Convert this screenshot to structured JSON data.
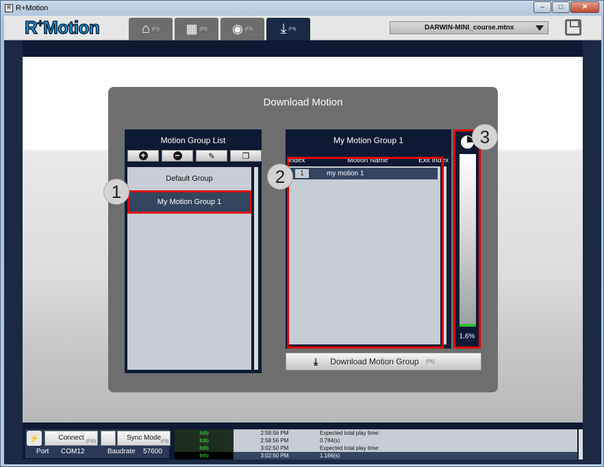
{
  "window": {
    "title": "R+Motion",
    "min": "–",
    "max": "□",
    "close": "✕"
  },
  "header": {
    "logo": {
      "prefix": "R",
      "plus": "+",
      "word": "Motion"
    },
    "tabs": [
      {
        "icon": "home-icon",
        "glyph": "⌂",
        "key": "(F1)"
      },
      {
        "icon": "film-icon",
        "glyph": "▦",
        "key": "(F2)"
      },
      {
        "icon": "reel-icon",
        "glyph": "◉",
        "key": "(F3)"
      },
      {
        "icon": "download-icon",
        "glyph": "⤓",
        "key": "(F4)"
      }
    ],
    "file": "DARWIN-MINI_course.mtnx"
  },
  "dialog": {
    "title": "Download Motion",
    "group_list": {
      "title": "Motion Group List",
      "tools": {
        "add": "+",
        "remove": "−",
        "edit": "✎",
        "copy": "❐"
      },
      "items": [
        "Default Group",
        "My Motion Group 1"
      ]
    },
    "motion_group": {
      "title": "My Motion Group 1",
      "columns": [
        "Index",
        "Motion Name",
        "Exit Index"
      ],
      "rows": [
        {
          "index": "1",
          "name": "my motion 1"
        }
      ]
    },
    "progress": {
      "percent_label": "1.6%",
      "value": 0.016
    },
    "download_button": {
      "icon": "⤓",
      "label": "Download Motion Group",
      "key": "(F6)"
    },
    "badges": [
      "1",
      "2",
      "3"
    ]
  },
  "status": {
    "connect": {
      "label": "Connect",
      "key": "(F10)"
    },
    "sync": {
      "label": "Sync Mode",
      "key": "(F9)"
    },
    "port_label": "Port",
    "port": "COM12",
    "baud_label": "Baudrate",
    "baud": "57600",
    "log": [
      {
        "level": "Info",
        "time": "2:58:56 PM",
        "msg": "Expected total play time:"
      },
      {
        "level": "Info",
        "time": "2:58:56 PM",
        "msg": "0.784(s)"
      },
      {
        "level": "Info",
        "time": "3:02:50 PM",
        "msg": "Expected total play time:"
      },
      {
        "level": "Info",
        "time": "3:02:50 PM",
        "msg": "1.166(s)"
      }
    ]
  }
}
